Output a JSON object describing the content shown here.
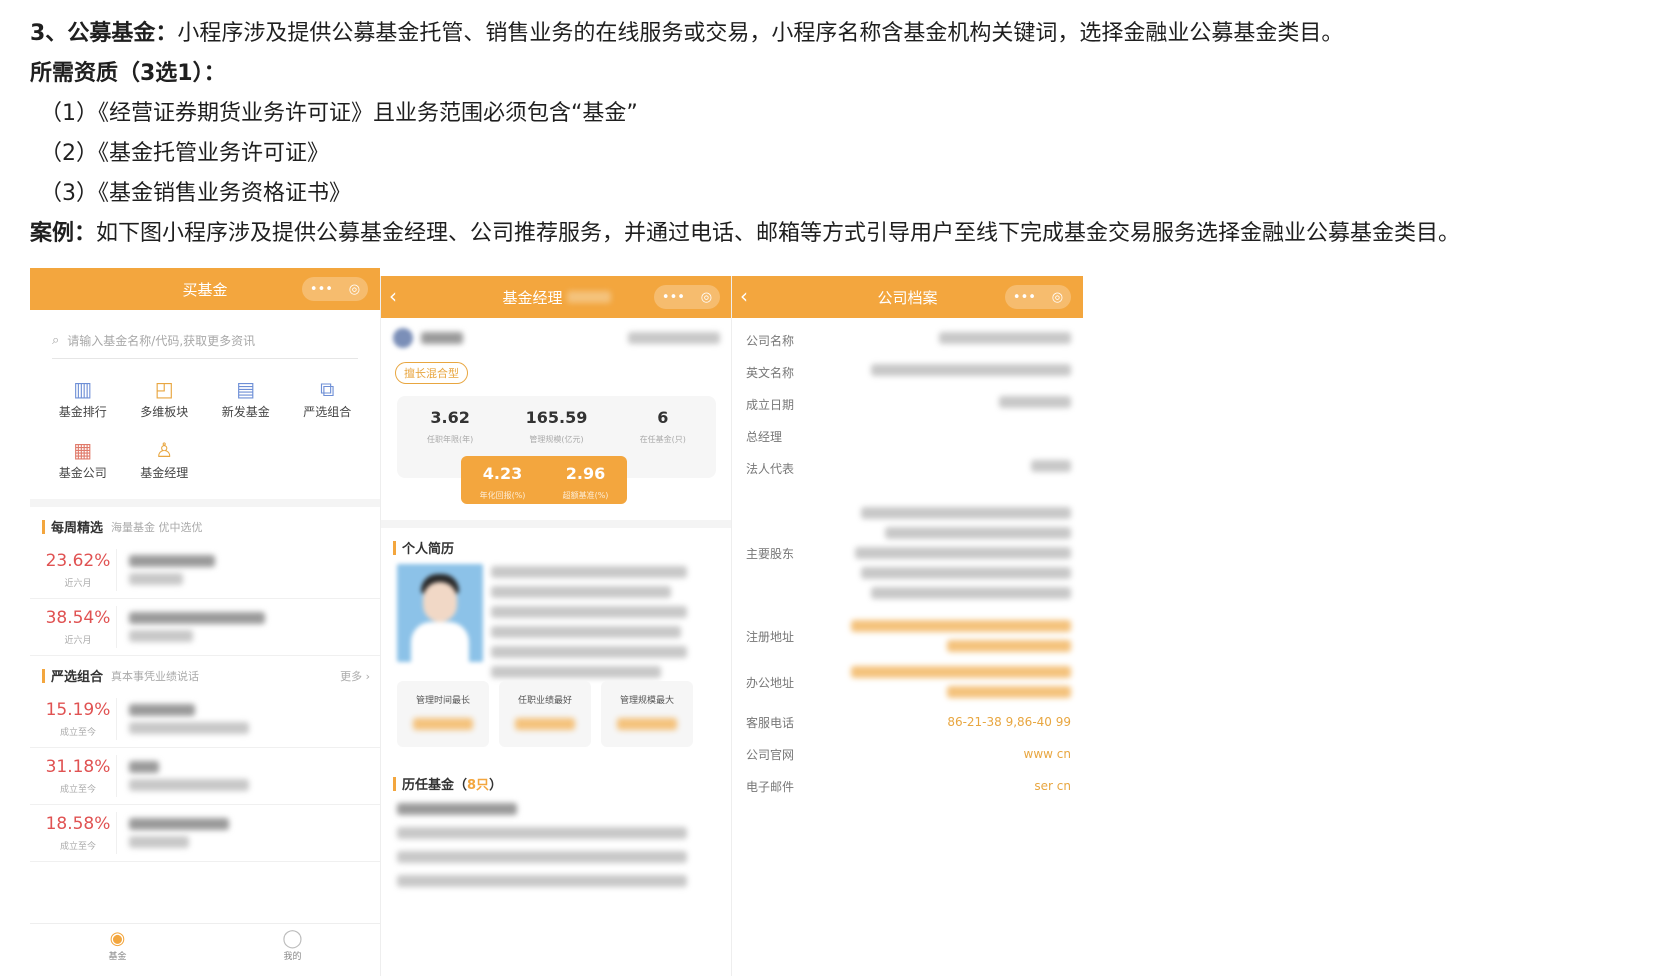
{
  "doc": {
    "heading_num": "3、",
    "heading_title": "公募基金：",
    "heading_text": "小程序涉及提供公募基金托管、销售业务的在线服务或交易，小程序名称含基金机构关键词，选择金融业公募基金类目。",
    "qual_title": "所需资质（3选1）：",
    "quals": [
      "（1）《经营证券期货业务许可证》且业务范围必须包含“基金”",
      "（2）《基金托管业务许可证》",
      "（3）《基金销售业务资格证书》"
    ],
    "case_label": "案例：",
    "case_text": "如下图小程序涉及提供公募基金经理、公司推荐服务，并通过电话、邮箱等方式引导用户至线下完成基金交易服务选择金融业公募基金类目。"
  },
  "phone1": {
    "title": "买基金",
    "search_placeholder": "请输入基金名称/代码,获取更多资讯",
    "grid": [
      {
        "label": "基金排行",
        "icon": "bar-chart-icon"
      },
      {
        "label": "多维板块",
        "icon": "board-icon"
      },
      {
        "label": "新发基金",
        "icon": "new-fund-icon"
      },
      {
        "label": "严选组合",
        "icon": "portfolio-icon"
      },
      {
        "label": "基金公司",
        "icon": "company-icon"
      },
      {
        "label": "基金经理",
        "icon": "manager-icon"
      }
    ],
    "weekly": {
      "title": "每周精选",
      "subtitle": "海量基金 优中选优"
    },
    "weekly_rows": [
      {
        "pct": "23.62%",
        "sub": "近六月"
      },
      {
        "pct": "38.54%",
        "sub": "近六月"
      }
    ],
    "strict": {
      "title": "严选组合",
      "subtitle": "真本事凭业绩说话",
      "more": "更多 ›"
    },
    "strict_rows": [
      {
        "pct": "15.19%",
        "sub": "成立至今"
      },
      {
        "pct": "31.18%",
        "sub": "成立至今"
      },
      {
        "pct": "18.58%",
        "sub": "成立至今"
      }
    ],
    "tabs": [
      {
        "label": "基金"
      },
      {
        "label": "我的"
      }
    ]
  },
  "phone2": {
    "title": "基金经理",
    "tag": "擅长混合型",
    "stats": [
      {
        "value": "3.62",
        "label": "任职年限(年)"
      },
      {
        "value": "165.59",
        "label": "管理规模(亿元)"
      },
      {
        "value": "6",
        "label": "在任基金(只)"
      }
    ],
    "highlights": [
      {
        "value": "4.23",
        "label": "年化回报(%)"
      },
      {
        "value": "2.96",
        "label": "超额基准(%)"
      }
    ],
    "resume_title": "个人简历",
    "cards": [
      "管理时间最长",
      "任职业绩最好",
      "管理规模最大"
    ],
    "history_title": "历任基金（",
    "history_count": "8只",
    "history_close": "）"
  },
  "phone3": {
    "title": "公司档案",
    "fields": [
      {
        "key": "公司名称"
      },
      {
        "key": "英文名称"
      },
      {
        "key": "成立日期"
      },
      {
        "key": "总经理"
      },
      {
        "key": "法人代表"
      },
      {
        "key": "主要股东"
      },
      {
        "key": "注册地址"
      },
      {
        "key": "办公地址"
      },
      {
        "key": "客服电话",
        "value": "86-21-38          9,86-40          99"
      },
      {
        "key": "公司官网",
        "value": "www                          cn"
      },
      {
        "key": "电子邮件",
        "value": "ser                                    cn"
      }
    ]
  },
  "colors": {
    "accent": "#f3a63e",
    "pct_red": "#e05252"
  }
}
